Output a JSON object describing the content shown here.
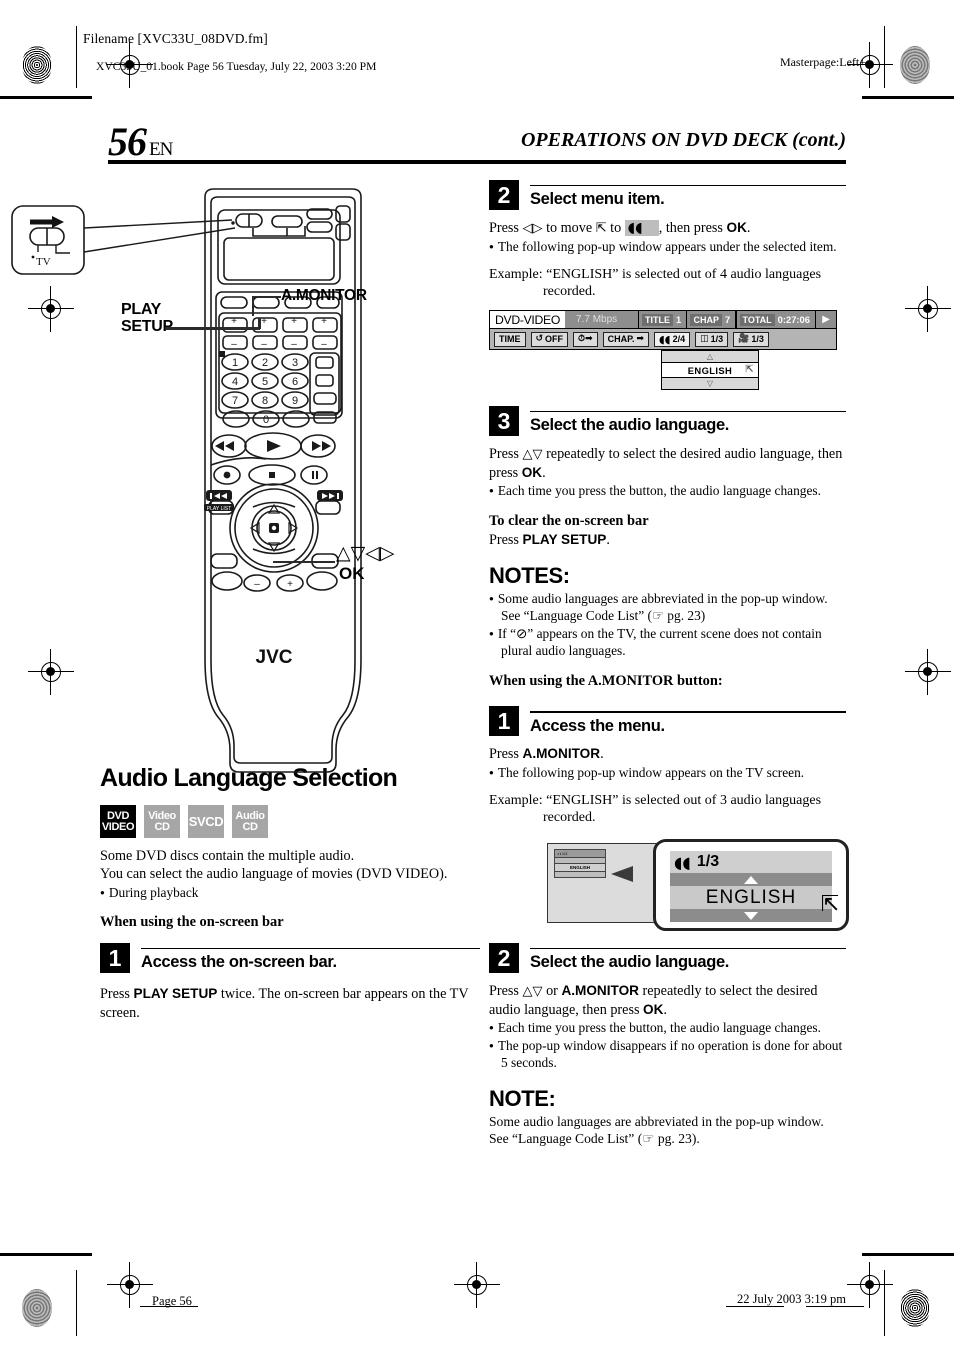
{
  "header": {
    "filename": "Filename [XVC33U_08DVD.fm]",
    "bookline": "XVC33U_01.book  Page 56  Tuesday, July 22, 2003  3:20 PM",
    "masterpage": "Masterpage:Left+"
  },
  "page": {
    "number": "56",
    "lang": "EN",
    "chapter_title": "OPERATIONS ON DVD DECK (cont.)"
  },
  "footer": {
    "left": "Page 56",
    "right": "22 July 2003 3:19 pm"
  },
  "remote": {
    "brand": "JVC",
    "callout_tv_switch": "TV",
    "labels": {
      "a_monitor": "A.MONITOR",
      "play": "PLAY",
      "setup": "SETUP",
      "arrows": "△▽◁▷",
      "ok": "OK"
    },
    "keypad": [
      "1",
      "2",
      "3",
      "4",
      "5",
      "6",
      "7",
      "8",
      "9",
      "0"
    ]
  },
  "section": {
    "title": "Audio Language Selection",
    "badges": [
      {
        "line1": "DVD",
        "line2": "VIDEO",
        "active": true
      },
      {
        "line1": "Video",
        "line2": "CD",
        "active": false
      },
      {
        "line1": "SVCD",
        "line2": "",
        "active": false
      },
      {
        "line1": "Audio",
        "line2": "CD",
        "active": false
      }
    ],
    "intro_line1": "Some DVD discs contain the multiple audio.",
    "intro_line2": "You can select the audio language of movies (DVD VIDEO).",
    "intro_bullet": "During playback",
    "subhead_onscreen": "When using the on-screen bar"
  },
  "steps_left": [
    {
      "num": "1",
      "title": "Access the on-screen bar.",
      "body_pre": "Press ",
      "body_bold": "PLAY SETUP",
      "body_post": " twice. The on-screen bar appears on the TV screen."
    }
  ],
  "steps_right": {
    "step2": {
      "num": "2",
      "title": "Select menu item.",
      "line_a": "Press ",
      "line_b": " to move ",
      "line_c": " to ",
      "line_d": ", then press ",
      "line_e": "OK",
      "line_f": ".",
      "bullet": "The following pop-up window appears under the selected item.",
      "example_label": "Example:",
      "example_text": "“ENGLISH” is selected out of 4 audio languages",
      "example_text2": "recorded."
    },
    "step3": {
      "num": "3",
      "title": "Select the audio language.",
      "line_a": "Press ",
      "line_b": " repeatedly to select the desired audio language, then press ",
      "line_c": "OK",
      "line_d": ".",
      "bullet": "Each time you press the button, the audio language changes.",
      "clear_head": "To clear the on-screen bar",
      "clear_pre": "Press ",
      "clear_bold": "PLAY SETUP",
      "clear_post": ".",
      "notes_head": "NOTES:",
      "note1": "Some audio languages are abbreviated in the pop-up window. See “Language Code List” (☞ pg. 23)",
      "note2": "If “⊘” appears on the TV, the current scene does not contain plural audio languages.",
      "amon_head": "When using the A.MONITOR button:"
    },
    "step1b": {
      "num": "1",
      "title": "Access the menu.",
      "line_pre": "Press ",
      "line_bold": "A.MONITOR",
      "line_post": ".",
      "bullet": "The following pop-up window appears on the TV screen.",
      "example_label": "Example:",
      "example_text": "“ENGLISH” is selected out of 3 audio languages",
      "example_text2": "recorded."
    },
    "step2b": {
      "num": "2",
      "title": "Select the audio language.",
      "line_a": "Press ",
      "line_b": " or ",
      "line_c": "A.MONITOR",
      "line_d": " repeatedly to select the desired audio language, then press ",
      "line_e": "OK",
      "line_f": ".",
      "bullet1": "Each time you press the button, the audio language changes.",
      "bullet2": "The pop-up window disappears if no operation is done for about 5 seconds.",
      "note_head": "NOTE:",
      "note_body": "Some audio languages are abbreviated in the pop-up window. See “Language Code List” (☞ pg. 23)."
    }
  },
  "osd_bar": {
    "disc_type": "DVD-VIDEO",
    "bitrate": "7.7 Mbps",
    "title_tag": "TITLE",
    "title_val": "1",
    "chap_tag": "CHAP",
    "chap_val": "7",
    "total_tag": "TOTAL",
    "total_val": "0:27:06",
    "play_icon": "▶",
    "buttons": [
      {
        "label": "TIME",
        "icon": ""
      },
      {
        "label": "OFF",
        "icon": "repeat-icon"
      },
      {
        "label": "",
        "icon": "clock-arrow-icon"
      },
      {
        "label": "CHAP.",
        "icon": "arrow-right-icon"
      },
      {
        "label": "2/4",
        "icon": "audio-icon",
        "selected": true
      },
      {
        "label": "1/3",
        "icon": "subtitle-icon"
      },
      {
        "label": "1/3",
        "icon": "angle-icon"
      }
    ],
    "popup_value": "ENGLISH",
    "popup_up": "△",
    "popup_down": "▽"
  },
  "tv_popup": {
    "audio_count": "1/3",
    "language": "ENGLISH"
  },
  "colors": {
    "badge_active": "#000000",
    "badge_inactive": "#a6a6a6",
    "osd_row1": "#8e8e8e",
    "osd_row2": "#b4b4b4",
    "callout_band": "#8c8c8c"
  }
}
